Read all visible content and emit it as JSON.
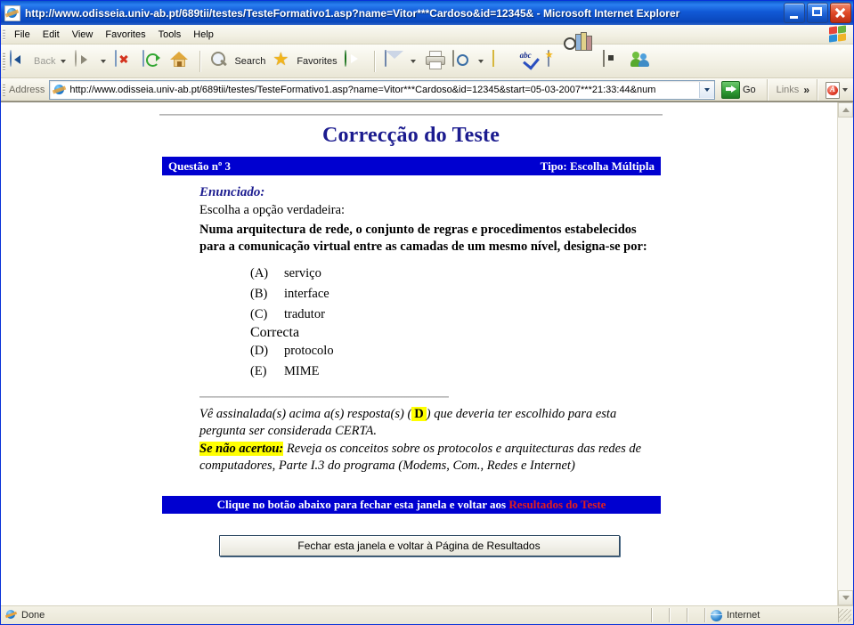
{
  "window": {
    "title": "http://www.odisseia.univ-ab.pt/689tii/testes/TesteFormativo1.asp?name=Vitor***Cardoso&id=12345& - Microsoft Internet Explorer",
    "icon": "ie-document-icon",
    "minimize_label": "Minimize",
    "maximize_label": "Maximize",
    "close_label": "Close"
  },
  "menu": {
    "items": [
      {
        "label": "File"
      },
      {
        "label": "Edit"
      },
      {
        "label": "View"
      },
      {
        "label": "Favorites"
      },
      {
        "label": "Tools"
      },
      {
        "label": "Help"
      }
    ]
  },
  "toolbar": {
    "back_label": "Back",
    "search_label": "Search",
    "favorites_label": "Favorites"
  },
  "address": {
    "label": "Address",
    "url": "http://www.odisseia.univ-ab.pt/689tii/testes/TesteFormativo1.asp?name=Vitor***Cardoso&id=12345&start=05-03-2007***21:33:44&num",
    "go_label": "Go",
    "links_label": "Links",
    "chevrons": "»"
  },
  "page": {
    "title": "Correcção do Teste",
    "question_bar": {
      "left": "Questão nº  3",
      "right": "Tipo: Escolha Múltipla"
    },
    "enunciado_label": "Enunciado:",
    "lead": "Escolha a opção verdadeira:",
    "stem": "Numa arquitectura de rede, o conjunto de regras e procedimentos estabelecidos para a comunicação virtual entre as camadas de um mesmo nível, designa-se por:",
    "correct_label": "Correcta",
    "options": [
      {
        "letter": "(A)",
        "text": "serviço",
        "correct": false
      },
      {
        "letter": "(B)",
        "text": "interface",
        "correct": false
      },
      {
        "letter": "(C)",
        "text": "tradutor",
        "correct": false
      },
      {
        "letter": "(D)",
        "text": "protocolo",
        "correct": true
      },
      {
        "letter": "(E)",
        "text": "MIME",
        "correct": false
      }
    ],
    "feedback": {
      "part1": "Vê assinalada(s) acima a(s) resposta(s) (",
      "answer": "D",
      "part2": ") que deveria ter escolhido para esta pergunta ser considerada CERTA.",
      "hint_label": "Se não acertou:",
      "hint_text": " Reveja os conceitos sobre os protocolos e arquitecturas das redes de computadores, Parte I.3 do programa (Modems, Com., Redes e Internet)"
    },
    "footer_bar": {
      "text": "Clique no botão abaixo para fechar esta janela e voltar aos ",
      "highlight": "Resultados do Teste"
    },
    "close_button": "Fechar esta janela e voltar à Página de Resultados"
  },
  "status": {
    "text": "Done",
    "zone": "Internet"
  },
  "colors": {
    "title_blue": "#1159d6",
    "bar_blue": "#0000d0",
    "heading_blue": "#1b1b8f",
    "correct_blue": "#2626a8",
    "highlight_yellow": "#ffff00",
    "red": "#e02020"
  }
}
